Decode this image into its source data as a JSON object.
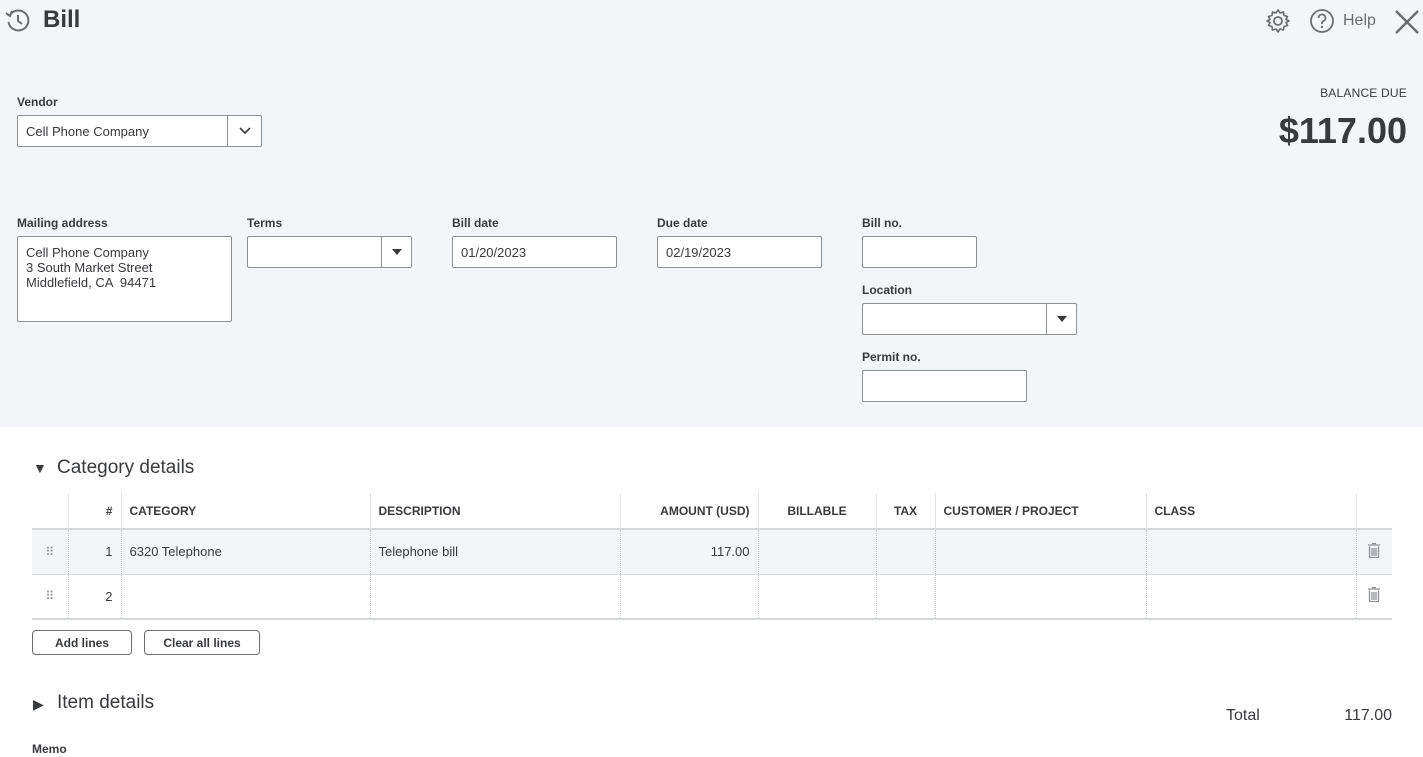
{
  "header": {
    "title": "Bill",
    "help_label": "Help"
  },
  "vendor": {
    "label": "Vendor",
    "value": "Cell Phone Company"
  },
  "balance": {
    "label": "BALANCE DUE",
    "amount": "$117.00"
  },
  "mailing": {
    "label": "Mailing address",
    "line1": "Cell Phone Company",
    "line2": "3 South Market Street",
    "line3": "Middlefield, CA  94471"
  },
  "terms": {
    "label": "Terms",
    "value": ""
  },
  "bill_date": {
    "label": "Bill date",
    "value": "01/20/2023"
  },
  "due_date": {
    "label": "Due date",
    "value": "02/19/2023"
  },
  "bill_no": {
    "label": "Bill no.",
    "value": ""
  },
  "location": {
    "label": "Location",
    "value": ""
  },
  "permit": {
    "label": "Permit no.",
    "value": ""
  },
  "category_section": {
    "title": "Category details",
    "toggle": "▼"
  },
  "table": {
    "headers": {
      "num": "#",
      "category": "CATEGORY",
      "description": "DESCRIPTION",
      "amount": "AMOUNT (USD)",
      "billable": "BILLABLE",
      "tax": "TAX",
      "customer": "CUSTOMER / PROJECT",
      "class": "CLASS"
    },
    "rows": [
      {
        "num": "1",
        "category": "6320 Telephone",
        "description": "Telephone bill",
        "amount": "117.00"
      },
      {
        "num": "2",
        "category": "",
        "description": "",
        "amount": ""
      }
    ]
  },
  "buttons": {
    "add_lines": "Add lines",
    "clear_lines": "Clear all lines"
  },
  "item_section": {
    "title": "Item details",
    "toggle": "▶"
  },
  "total": {
    "label": "Total",
    "value": "117.00"
  },
  "memo": {
    "label": "Memo"
  },
  "icons": {
    "history": "history-icon",
    "settings": "gear-icon",
    "help": "help-icon",
    "close": "close-icon",
    "trash": "trash-icon",
    "drag": "drag-handle-icon",
    "chevron": "chevron-down-icon",
    "caret": "caret-down-icon"
  },
  "colors": {
    "header_bg": "#f4f5f8",
    "text": "#393a3d",
    "border": "#8d9096"
  }
}
